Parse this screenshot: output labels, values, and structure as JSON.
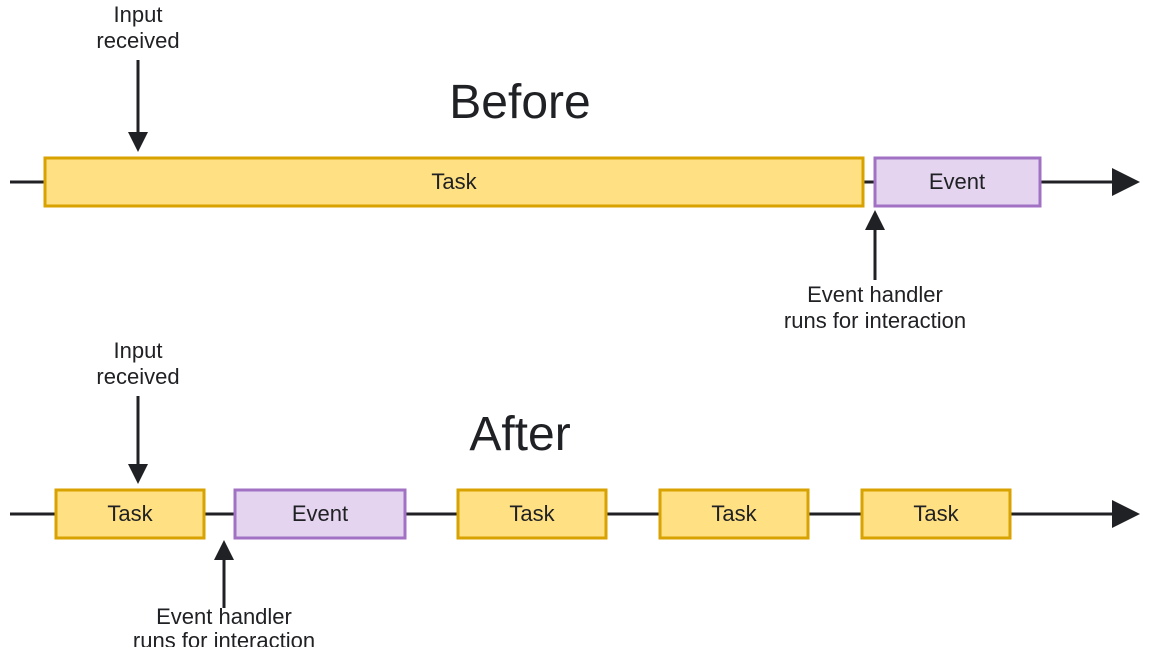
{
  "before": {
    "title": "Before",
    "input_label_l1": "Input",
    "input_label_l2": "received",
    "handler_label_l1": "Event handler",
    "handler_label_l2": "runs for interaction",
    "blocks": {
      "task": "Task",
      "event": "Event"
    }
  },
  "after": {
    "title": "After",
    "input_label_l1": "Input",
    "input_label_l2": "received",
    "handler_label_l1": "Event handler",
    "handler_label_l2": "runs for interaction",
    "blocks": {
      "task1": "Task",
      "event": "Event",
      "task2": "Task",
      "task3": "Task",
      "task4": "Task"
    }
  }
}
